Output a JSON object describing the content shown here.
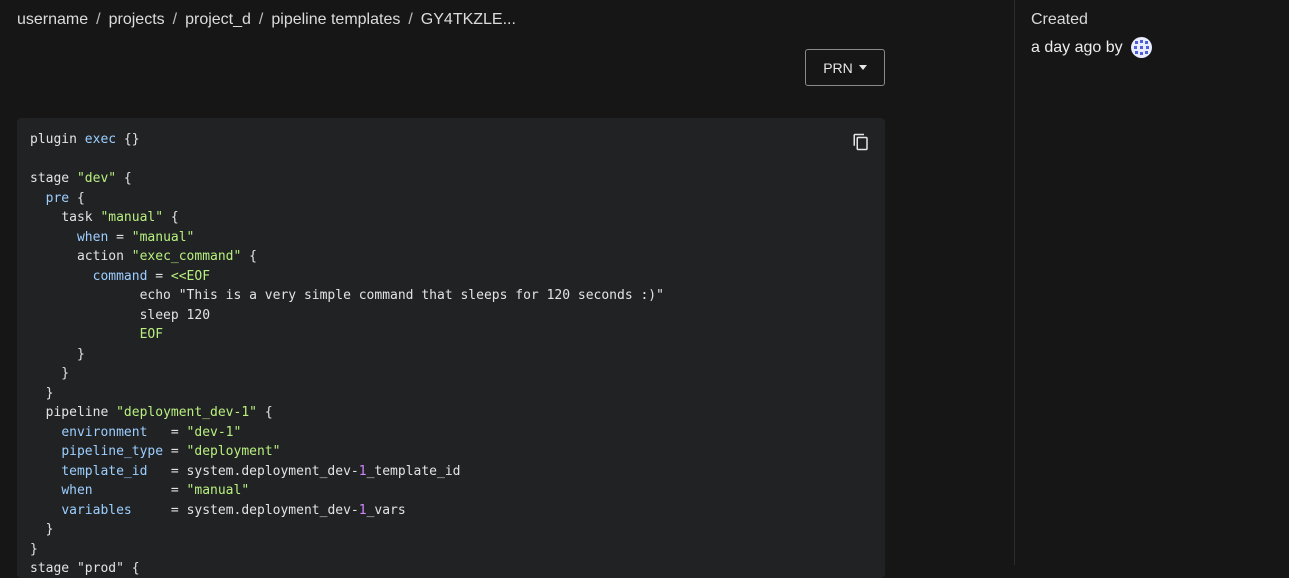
{
  "breadcrumb": {
    "items": [
      "username",
      "projects",
      "project_d",
      "pipeline templates",
      "GY4TKZLE..."
    ],
    "separator": "/"
  },
  "toolbar": {
    "prn_label": "PRN"
  },
  "code": {
    "line1": "plugin ",
    "line1_k": "exec",
    "line1_end": " {}",
    "stage_dev": "stage ",
    "dev_s": "\"dev\"",
    "open": " {",
    "pre": "pre",
    "task": "task ",
    "manual_s": "\"manual\"",
    "when": "when",
    "eq": " = ",
    "action": "action ",
    "exec_command_s": "\"exec_command\"",
    "command": "command",
    "heredoc": "<<EOF",
    "echo_line": "echo \"This is a very simple command that sleeps for 120 seconds :)\"",
    "sleep_line": "sleep 120",
    "eof": "EOF",
    "pipeline": "pipeline ",
    "deployment_dev_s": "\"deployment_dev-1\"",
    "environment": "environment",
    "env_pad": "   = ",
    "dev1_s": "\"dev-1\"",
    "pipeline_type": "pipeline_type",
    "deployment_s": "\"deployment\"",
    "template_id": "template_id",
    "tid_pad": "   = ",
    "system_prefix": "system.deployment_dev-",
    "one": "1",
    "template_suffix": "_template_id",
    "when_pad": "          = ",
    "variables": "variables",
    "var_pad": "     = ",
    "vars_suffix": "_vars",
    "last_partial": "stage \"prod\" {"
  },
  "side": {
    "created_label": "Created",
    "created_value": "a day ago by"
  },
  "colors": {
    "background": "#161616",
    "code_bg": "#212224",
    "keyword": "#9ccfff",
    "string": "#b8f07f",
    "number": "#d186ff"
  },
  "icons": [
    "copy-icon",
    "caret-down-icon",
    "avatar-identicon"
  ]
}
